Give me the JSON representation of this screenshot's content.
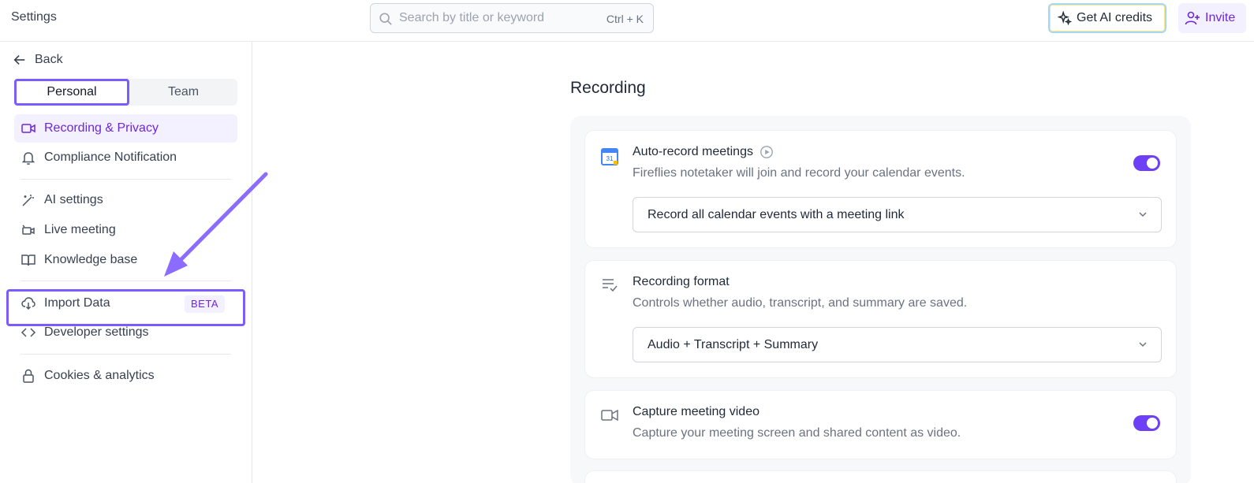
{
  "header": {
    "title": "Settings",
    "search_placeholder": "Search by title or keyword",
    "search_shortcut": "Ctrl + K",
    "ai_credits_label": "Get AI credits",
    "invite_label": "Invite"
  },
  "sidebar": {
    "back_label": "Back",
    "tabs": [
      {
        "label": "Personal",
        "active": true
      },
      {
        "label": "Team",
        "active": false
      }
    ],
    "items": [
      {
        "label": "Recording & Privacy",
        "icon": "video-icon",
        "active": true
      },
      {
        "label": "Compliance Notification",
        "icon": "bell-icon"
      },
      {
        "label": "AI settings",
        "icon": "magic-wand-icon"
      },
      {
        "label": "Live meeting",
        "icon": "live-camera-icon"
      },
      {
        "label": "Knowledge base",
        "icon": "book-icon"
      },
      {
        "label": "Import Data",
        "icon": "cloud-download-icon",
        "badge": "BETA"
      },
      {
        "label": "Developer settings",
        "icon": "code-icon"
      },
      {
        "label": "Cookies & analytics",
        "icon": "lock-icon"
      }
    ]
  },
  "main": {
    "section_title": "Recording",
    "cards": [
      {
        "title": "Auto-record meetings",
        "description": "Fireflies notetaker will join and record your calendar events.",
        "select_value": "Record all calendar events with a meeting link",
        "toggle_on": true,
        "icon": "google-calendar-icon",
        "calendar_day": "31"
      },
      {
        "title": "Recording format",
        "description": "Controls whether audio, transcript, and summary are saved.",
        "select_value": "Audio + Transcript + Summary",
        "icon": "list-check-icon"
      },
      {
        "title": "Capture meeting video",
        "description": "Capture your meeting screen and shared content as video.",
        "toggle_on": true,
        "icon": "video-icon"
      }
    ]
  },
  "colors": {
    "accent": "#6d3ff5",
    "highlight": "#7c5cff",
    "active_bg": "#f3f0ff"
  }
}
